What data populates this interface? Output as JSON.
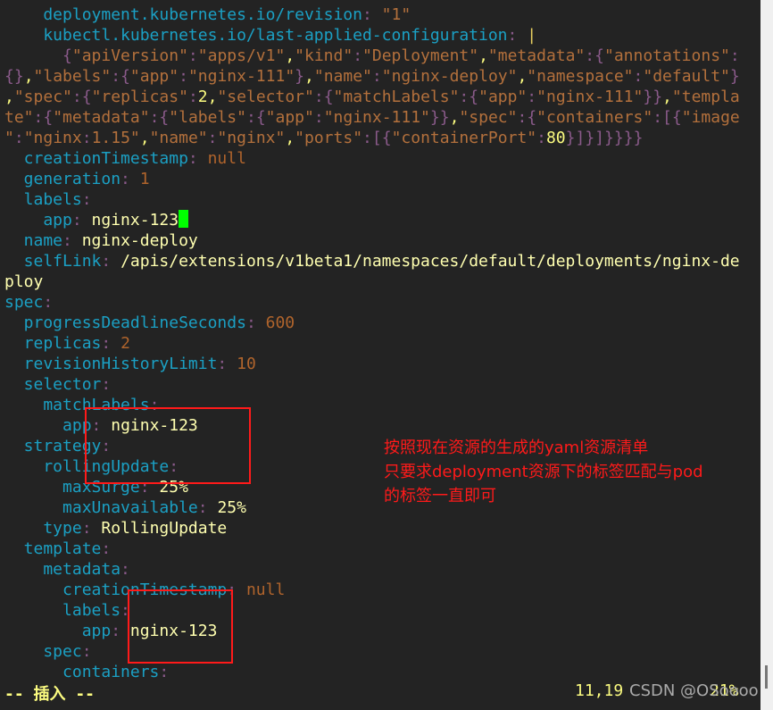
{
  "editor": {
    "lines": [
      {
        "key": "    deployment.kubernetes.io/revision",
        "value": "\"1\"",
        "vt": "s"
      },
      {
        "key": "    kubectl.kubernetes.io/last-applied-configuration",
        "value": "|",
        "vt": "c"
      },
      {
        "raw": "      {\"apiVersion\":\"apps/v1\",\"kind\":\"Deployment\",\"metadata\":{\"annotations\":"
      },
      {
        "raw": "{},\"labels\":{\"app\":\"nginx-111\"},\"name\":\"nginx-deploy\",\"namespace\":\"default\"}"
      },
      {
        "raw": ",\"spec\":{\"replicas\":2,\"selector\":{\"matchLabels\":{\"app\":\"nginx-111\"}},\"templa"
      },
      {
        "raw": "te\":{\"metadata\":{\"labels\":{\"app\":\"nginx-111\"}},\"spec\":{\"containers\":[{\"image"
      },
      {
        "raw": "\":\"nginx:1.15\",\"name\":\"nginx\",\"ports\":[{\"containerPort\":80}]}]}}}}"
      },
      {
        "key": "  creationTimestamp",
        "value": "null",
        "vt": "n"
      },
      {
        "key": "  generation",
        "value": "1",
        "vt": "n"
      },
      {
        "key": "  labels",
        "value": "",
        "vt": "v"
      },
      {
        "key": "    app",
        "value": "nginx-123",
        "vt": "v",
        "cursor": true
      },
      {
        "key": "  name",
        "value": "nginx-deploy",
        "vt": "v"
      },
      {
        "key": "  selfLink",
        "value": "/apis/extensions/v1beta1/namespaces/default/deployments/nginx-de",
        "vt": "v"
      },
      {
        "plain": "ploy",
        "vt": "v"
      },
      {
        "key": "spec",
        "value": "",
        "vt": "v"
      },
      {
        "key": "  progressDeadlineSeconds",
        "value": "600",
        "vt": "n"
      },
      {
        "key": "  replicas",
        "value": "2",
        "vt": "n"
      },
      {
        "key": "  revisionHistoryLimit",
        "value": "10",
        "vt": "n"
      },
      {
        "key": "  selector",
        "value": "",
        "vt": "v"
      },
      {
        "key": "    matchLabels",
        "value": "",
        "vt": "v"
      },
      {
        "key": "      app",
        "value": "nginx-123",
        "vt": "v"
      },
      {
        "key": "  strategy",
        "value": "",
        "vt": "v"
      },
      {
        "key": "    rollingUpdate",
        "value": "",
        "vt": "v"
      },
      {
        "key": "      maxSurge",
        "value": "25%",
        "vt": "v"
      },
      {
        "key": "      maxUnavailable",
        "value": "25%",
        "vt": "v"
      },
      {
        "key": "    type",
        "value": "RollingUpdate",
        "vt": "v"
      },
      {
        "key": "  template",
        "value": "",
        "vt": "v"
      },
      {
        "key": "    metadata",
        "value": "",
        "vt": "v"
      },
      {
        "key": "      creationTimestamp",
        "value": "null",
        "vt": "n"
      },
      {
        "key": "      labels",
        "value": "",
        "vt": "v"
      },
      {
        "key": "        app",
        "value": "nginx-123",
        "vt": "v"
      },
      {
        "key": "    spec",
        "value": "",
        "vt": "v"
      },
      {
        "key": "      containers",
        "value": "",
        "vt": "v"
      }
    ]
  },
  "annotation": {
    "lines": [
      "按照现在资源的生成的yaml资源清单",
      "只要求deployment资源下的标签匹配与pod",
      "的标签一直即可"
    ],
    "color": "#ff1a1a"
  },
  "status": {
    "mode": "-- 插入 --",
    "position": "11,19",
    "percent": "21%",
    "watermark": "CSDN @OSoooo"
  }
}
